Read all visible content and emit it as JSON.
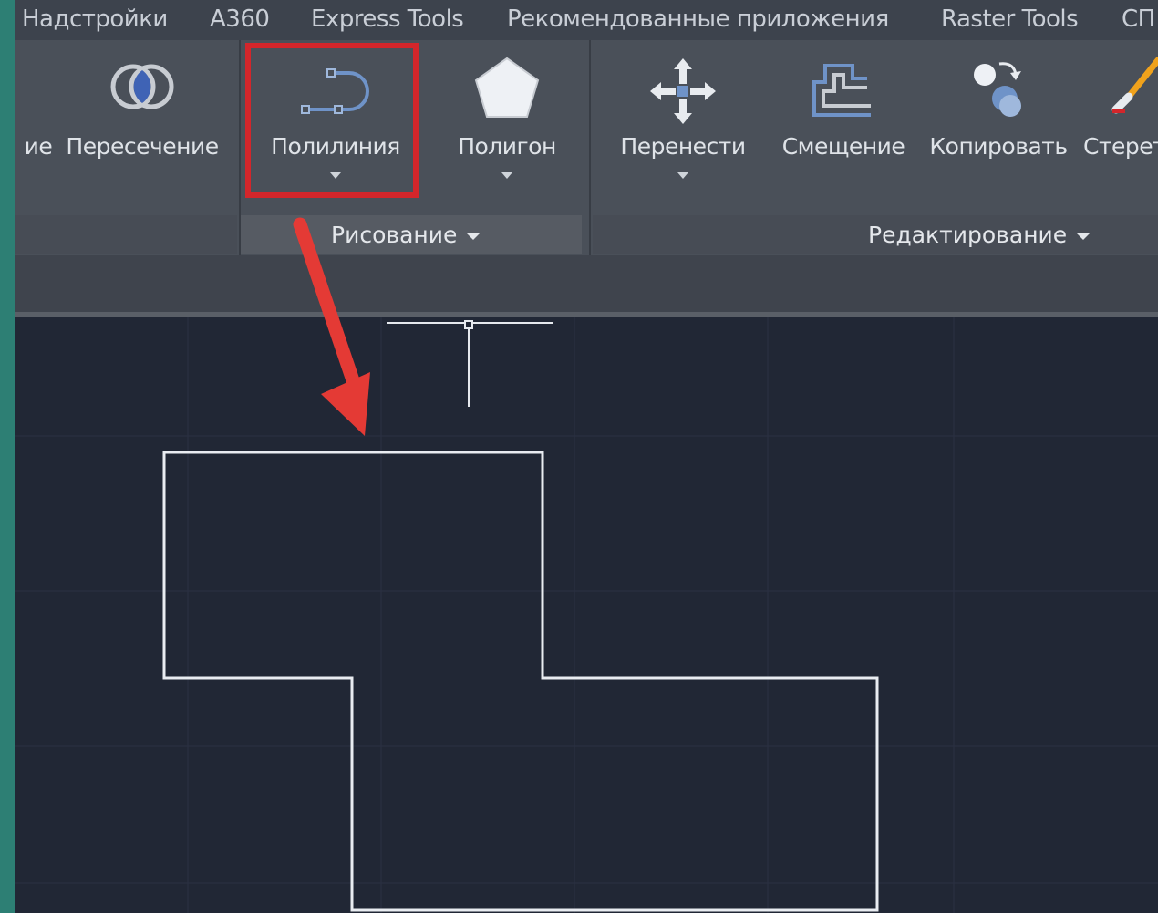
{
  "menu": {
    "tabs": [
      "Надстройки",
      "A360",
      "Express Tools",
      "Рекомендованные приложения",
      "Raster Tools",
      "СП"
    ]
  },
  "ribbon": {
    "buttons": {
      "partial": "ие",
      "intersection": "Пересечение",
      "polyline": "Полилиния",
      "polygon": "Полигон",
      "move": "Перенести",
      "offset": "Смещение",
      "copy": "Копировать",
      "erase": "Стерет"
    },
    "panels": {
      "draw": "Рисование",
      "modify": "Редактирование"
    }
  },
  "colors": {
    "accent_highlight": "#d3262b",
    "arrow": "#e43a35",
    "canvas_bg": "#212735",
    "ribbon_bg": "#4a5059",
    "icon_blue": "#6f93c8"
  },
  "icons": [
    "intersect-icon",
    "polyline-icon",
    "polygon-icon",
    "move-icon",
    "offset-icon",
    "copy-icon",
    "eraser-icon"
  ]
}
